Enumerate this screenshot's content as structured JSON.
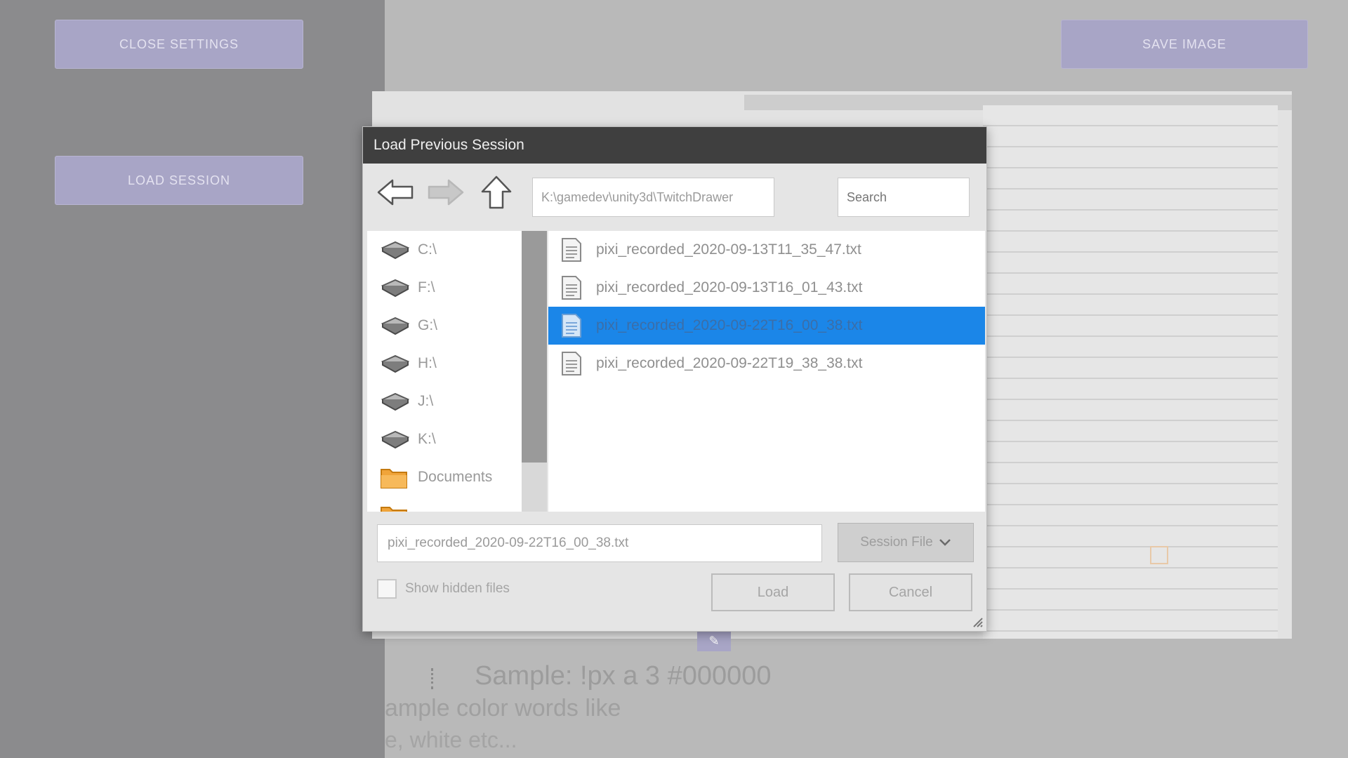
{
  "left_panel": {
    "close_settings_label": "CLOSE SETTINGS",
    "load_session_label": "LOAD SESSION"
  },
  "toolbar": {
    "save_image_label": "SAVE IMAGE"
  },
  "dialog": {
    "title": "Load Previous Session",
    "path_value": "K:\\gamedev\\unity3d\\TwitchDrawer",
    "search_placeholder": "Search",
    "sidebar": {
      "items": [
        {
          "label": "C:\\",
          "icon": "drive-icon"
        },
        {
          "label": "F:\\",
          "icon": "drive-icon"
        },
        {
          "label": "G:\\",
          "icon": "drive-icon"
        },
        {
          "label": "H:\\",
          "icon": "drive-icon"
        },
        {
          "label": "J:\\",
          "icon": "drive-icon"
        },
        {
          "label": "K:\\",
          "icon": "drive-icon"
        },
        {
          "label": "Documents",
          "icon": "folder-icon"
        },
        {
          "label": "",
          "icon": "folder-icon"
        }
      ]
    },
    "files": [
      {
        "name": "pixi_recorded_2020-09-13T11_35_47.txt",
        "selected": false
      },
      {
        "name": "pixi_recorded_2020-09-13T16_01_43.txt",
        "selected": false
      },
      {
        "name": "pixi_recorded_2020-09-22T16_00_38.txt",
        "selected": true
      },
      {
        "name": "pixi_recorded_2020-09-22T19_38_38.txt",
        "selected": false
      }
    ],
    "filename_value": "pixi_recorded_2020-09-22T16_00_38.txt",
    "filter_label": "Session File",
    "show_hidden_label": "Show hidden files",
    "load_label": "Load",
    "cancel_label": "Cancel"
  },
  "background": {
    "sample_line_1": "Sample: !px a 3 #000000",
    "sample_line_2": "ample color words like",
    "sample_line_3": "e, white etc...",
    "pencil_icon": "pencil-icon"
  },
  "colors": {
    "panel_button": "#a8a5c6",
    "selection": "#1b86e8",
    "title_bar": "#3f3f3f"
  }
}
